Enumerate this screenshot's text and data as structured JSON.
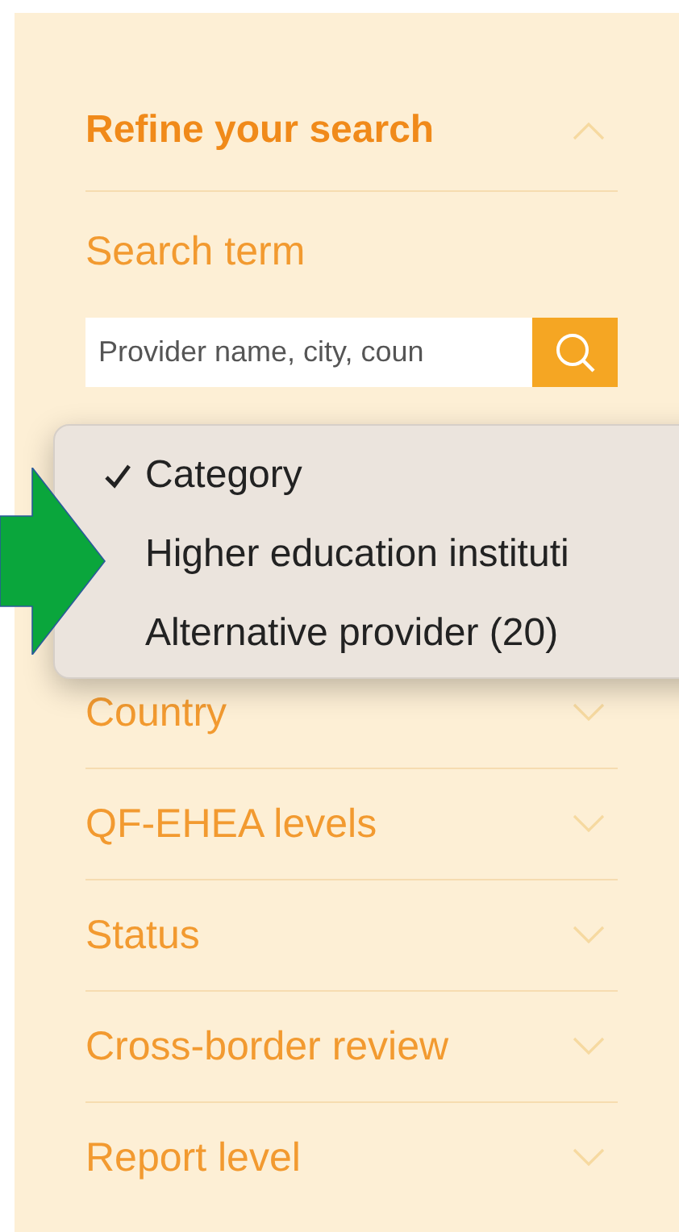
{
  "panel": {
    "title": "Refine your search",
    "expanded": true,
    "search": {
      "label": "Search term",
      "placeholder": "Provider name, city, coun"
    },
    "filters": [
      {
        "label": "Country",
        "expanded": false
      },
      {
        "label": "QF-EHEA levels",
        "expanded": false
      },
      {
        "label": "Status",
        "expanded": false
      },
      {
        "label": "Cross-border review",
        "expanded": false
      },
      {
        "label": "Report level",
        "expanded": false
      }
    ]
  },
  "dropdown": {
    "items": [
      {
        "label": "Category",
        "checked": true
      },
      {
        "label": "Higher education instituti",
        "checked": false
      },
      {
        "label": "Alternative provider (20)",
        "checked": false
      }
    ]
  }
}
